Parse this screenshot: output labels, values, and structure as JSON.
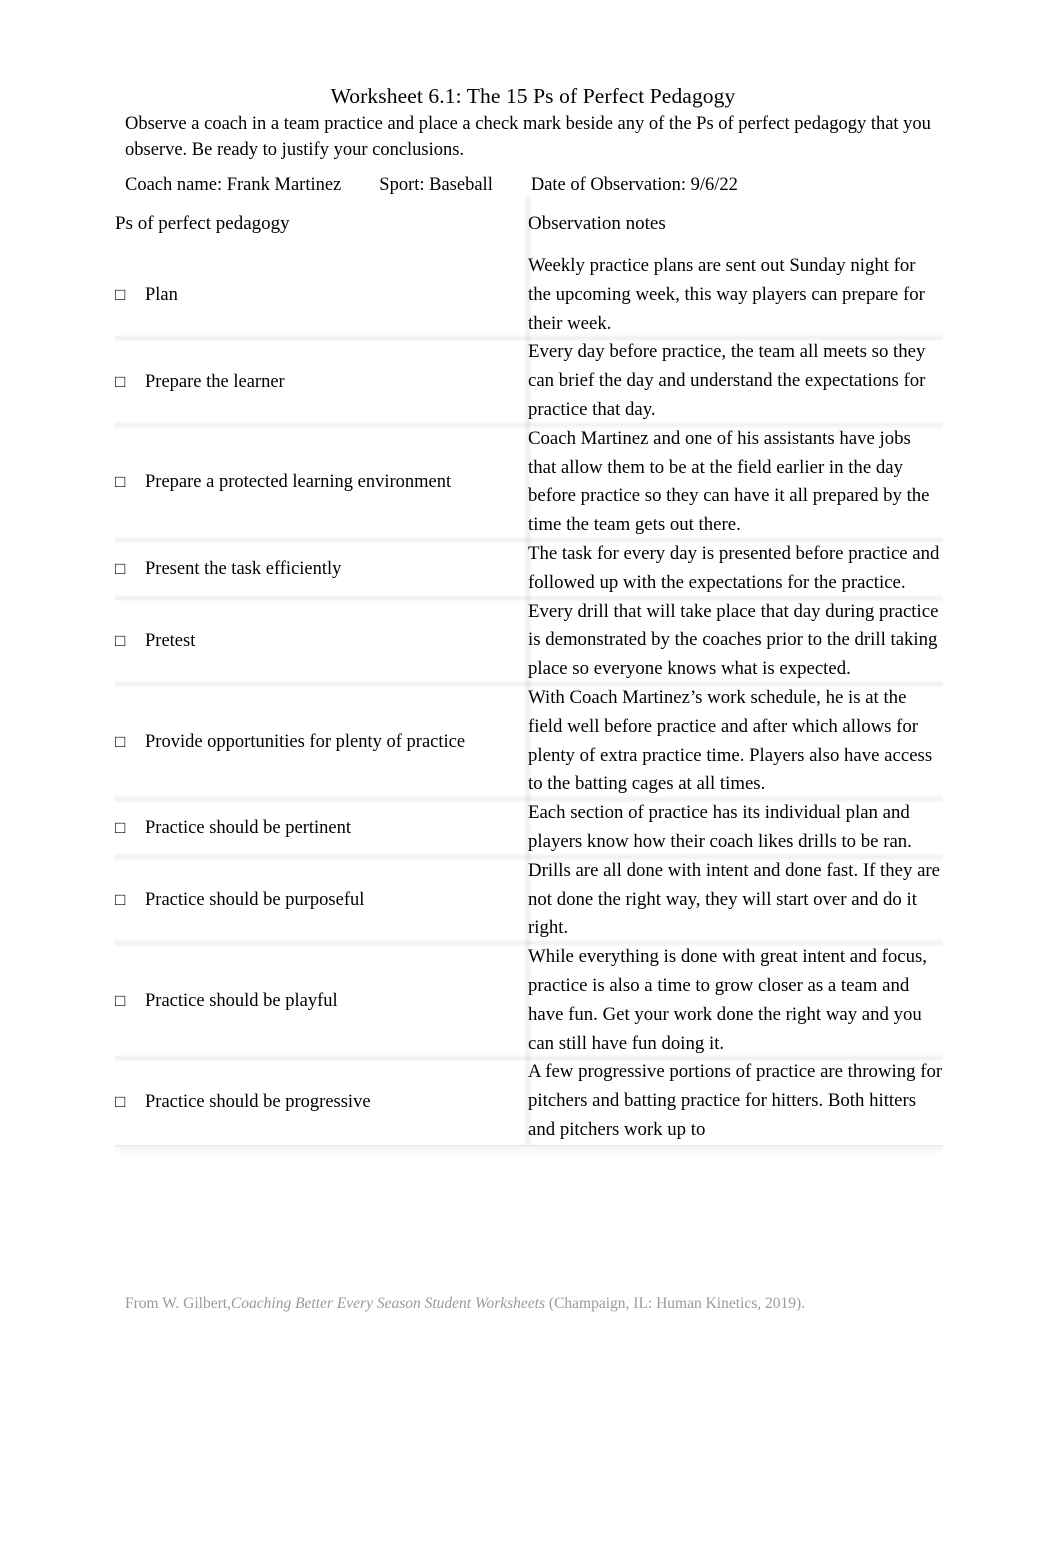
{
  "document": {
    "title": "Worksheet 6.1: The 15 Ps of Perfect Pedagogy",
    "instructions": "Observe a coach in a team practice and place a check mark beside any of the Ps of perfect pedagogy that you observe. Be ready to justify your conclusions."
  },
  "meta": {
    "coach_label": "Coach name:",
    "coach_value": "Frank Martinez",
    "sport_label": "Sport:",
    "sport_value": "Baseball",
    "date_label": "Date of Observation:",
    "date_value": "9/6/22",
    "coach_line": "Coach name: Frank Martinez",
    "sport_line": "Sport: Baseball",
    "date_line": "Date of Observation: 9/6/22"
  },
  "table": {
    "headers": {
      "ps": "Ps of perfect pedagogy",
      "notes": "Observation notes"
    },
    "checkbox_glyph": "□",
    "rows": [
      {
        "checked": false,
        "label": "Plan",
        "notes": "Weekly practice plans are sent out Sunday night for the upcoming week, this way players can prepare for their week."
      },
      {
        "checked": false,
        "label": "Prepare the learner",
        "notes": "Every day before practice, the team all meets so they can brief the day and understand the expectations for practice that day."
      },
      {
        "checked": false,
        "label": "Prepare a protected learning environment",
        "notes": "Coach Martinez and one of his assistants have jobs that allow them to be at the field earlier in the day before practice so they can have it all prepared by the time the team gets out there."
      },
      {
        "checked": false,
        "label": "Present the task efficiently",
        "notes": "The task for every day is presented before practice and followed up with the expectations for the practice."
      },
      {
        "checked": false,
        "label": "Pretest",
        "notes": "Every drill that will take place that day during practice is demonstrated by the coaches prior to the drill taking place so everyone knows what is expected."
      },
      {
        "checked": false,
        "label": "Provide opportunities for plenty of practice",
        "notes": "With Coach Martinez’s work schedule, he is at the field well before practice and after which allows for plenty of extra practice time. Players also have access to the batting cages at all times."
      },
      {
        "checked": false,
        "label": "Practice should be pertinent",
        "notes": "Each section of practice has its individual plan and players know how their coach likes drills to be ran."
      },
      {
        "checked": false,
        "label": "Practice should be purposeful",
        "notes": "Drills are all done with intent and done fast. If they are not done the right way, they will start over and do it right."
      },
      {
        "checked": false,
        "label": "Practice should be playful",
        "notes": "While everything is done with great intent and focus, practice is also a time to grow closer as a team and have fun. Get your work done the right way and you can still have fun doing it."
      },
      {
        "checked": false,
        "label": "Practice should be progressive",
        "notes": "A few progressive portions of practice are throwing for pitchers and batting practice for hitters. Both hitters and pitchers work up to"
      }
    ]
  },
  "footer": {
    "prefix": "From W. Gilbert,",
    "book": "Coaching Better Every Season Student Worksheets",
    "suffix": "(Champaign, IL: Human Kinetics, 2019)."
  }
}
